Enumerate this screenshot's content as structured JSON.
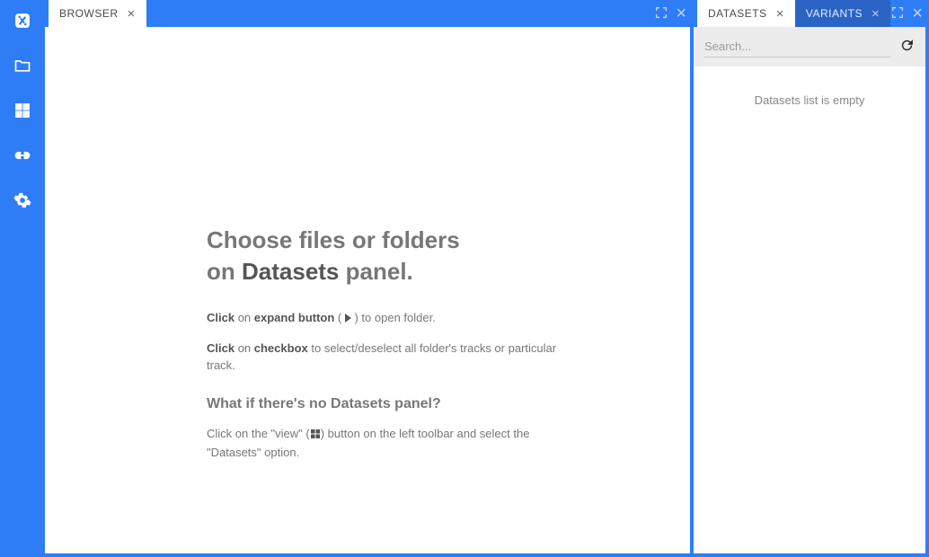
{
  "sidebar": {
    "items": [
      {
        "name": "logo",
        "icon": "logo"
      },
      {
        "name": "folder",
        "icon": "folder"
      },
      {
        "name": "view",
        "icon": "grid"
      },
      {
        "name": "link",
        "icon": "link"
      },
      {
        "name": "settings",
        "icon": "gear"
      }
    ]
  },
  "main": {
    "tab_label": "BROWSER",
    "help": {
      "title_line1": "Choose files or folders",
      "title_line2_pre": "on ",
      "title_line2_em": "Datasets",
      "title_line2_post": " panel.",
      "p1_b1": "Click",
      "p1_t1": " on ",
      "p1_b2": "expand button",
      "p1_t2": " ( ",
      "p1_t3": " ) to open folder.",
      "p2_b1": "Click",
      "p2_t1": " on ",
      "p2_b2": "checkbox",
      "p2_t2": " to select/deselect all folder's tracks or particular track.",
      "sub": "What if there's no Datasets panel?",
      "p3_t1": "Click on the \"view\" (",
      "p3_t2": ") button on the left toolbar and select the \"Datasets\" option."
    }
  },
  "right": {
    "tab1_label": "DATASETS",
    "tab2_label": "VARIANTS",
    "search_placeholder": "Search...",
    "empty_msg": "Datasets list is empty"
  }
}
